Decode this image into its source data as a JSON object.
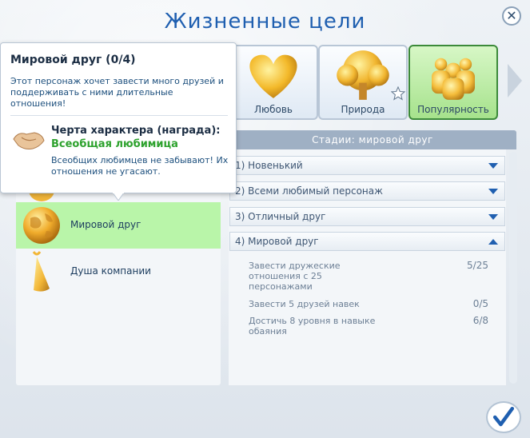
{
  "window": {
    "title": "Жизненные цели",
    "close_symbol": "✕"
  },
  "categories": [
    {
      "label": "Любовь",
      "icon": "heart-icon",
      "active": false
    },
    {
      "label": "Природа",
      "icon": "tree-icon",
      "active": false
    },
    {
      "label": "Популярность",
      "icon": "crowd-icon",
      "active": true
    }
  ],
  "goals": [
    {
      "label": "Мировой друг",
      "icon": "globe-icon",
      "active": true
    },
    {
      "label": "Душа компании",
      "icon": "party-hat-icon",
      "active": false
    }
  ],
  "stages_panel": {
    "header": "Стадии: мировой друг",
    "stages": [
      {
        "label": "1) Новенький",
        "expanded": false
      },
      {
        "label": "2) Всеми любимый персонаж",
        "expanded": false
      },
      {
        "label": "3) Отличный друг",
        "expanded": false
      },
      {
        "label": "4) Мировой друг",
        "expanded": true
      }
    ],
    "tasks": [
      {
        "text": "Завести дружеские отношения с 25 персонажами",
        "progress": "5/25"
      },
      {
        "text": "Завести 5 друзей навек",
        "progress": "0/5"
      },
      {
        "text": "Достичь 8 уровня в навыке обаяния",
        "progress": "6/8"
      }
    ]
  },
  "tooltip": {
    "title": "Мировой друг (0/4)",
    "description": "Этот персонаж хочет завести много друзей и поддерживать с ними длительные отношения!",
    "trait_heading": "Черта характера (награда):",
    "trait_name": "Всеобщая любимица",
    "trait_description": "Всеобщих любимцев не забывают! Их отношения не угасают."
  },
  "colors": {
    "title_blue": "#1f5fb0",
    "active_green": "#b9f5a9",
    "trait_green": "#2ea22e"
  }
}
